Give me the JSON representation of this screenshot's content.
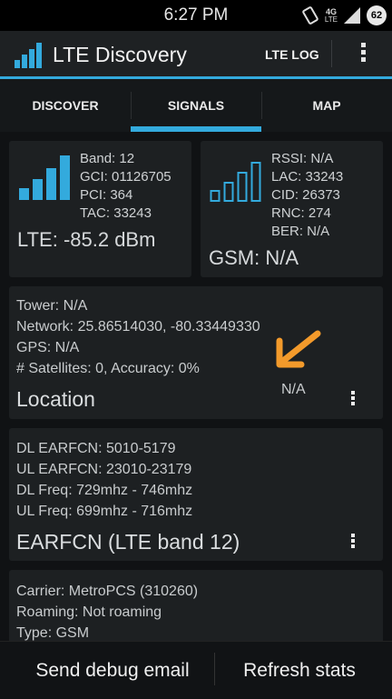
{
  "status_bar": {
    "time": "6:27 PM",
    "network_type": "4G",
    "lte_label": "LTE",
    "battery_level": "62"
  },
  "action_bar": {
    "title": "LTE Discovery",
    "log_button": "LTE LOG",
    "accent_color": "#33aadd"
  },
  "tabs": [
    {
      "label": "DISCOVER",
      "active": false
    },
    {
      "label": "SIGNALS",
      "active": true
    },
    {
      "label": "MAP",
      "active": false
    }
  ],
  "lte_card": {
    "lines": [
      "Band: 12",
      "GCI: 01126705",
      "PCI: 364",
      "TAC: 33243"
    ],
    "signal": "LTE: -85.2 dBm",
    "bars_filled": 4
  },
  "gsm_card": {
    "lines": [
      "RSSI: N/A",
      "LAC: 33243",
      "CID: 26373",
      "RNC: 274",
      "BER: N/A"
    ],
    "signal": "GSM: N/A",
    "bars_filled": 0
  },
  "location_card": {
    "lines": [
      "Tower: N/A",
      "Network: 25.86514030, -80.33449330",
      "GPS: N/A",
      "# Satellites: 0, Accuracy: 0%"
    ],
    "title": "Location",
    "side_value": "N/A"
  },
  "earfcn_card": {
    "lines": [
      "DL EARFCN: 5010-5179",
      "UL EARFCN: 23010-23179",
      "DL Freq: 729mhz - 746mhz",
      "UL Freq: 699mhz - 716mhz"
    ],
    "title": "EARFCN (LTE band 12)"
  },
  "carrier_card": {
    "lines": [
      "Carrier: MetroPCS (310260)",
      "Roaming: Not roaming",
      "Type: GSM"
    ]
  },
  "bottom_bar": {
    "debug_button": "Send debug email",
    "refresh_button": "Refresh stats"
  },
  "annotation_color": "#f39a2b"
}
